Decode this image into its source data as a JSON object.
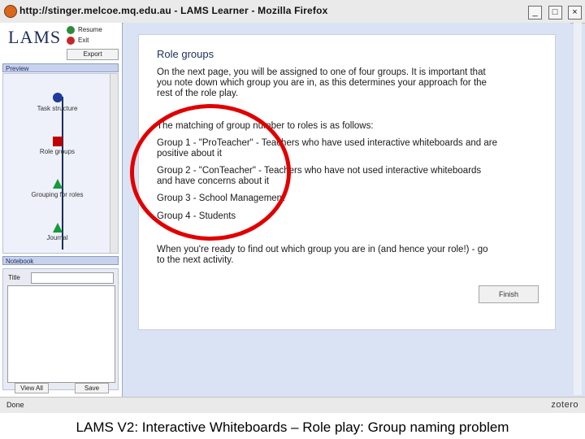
{
  "window": {
    "title": "http://stinger.melcoe.mq.edu.au - LAMS Learner - Mozilla Firefox",
    "minimize": "_",
    "maximize": "□",
    "close": "×"
  },
  "sidebar": {
    "logo": "LAMS",
    "resume_label": "Resume",
    "exit_label": "Exit",
    "export_label": "Export",
    "preview_header": "Preview",
    "sequence": [
      {
        "label": "Task structure",
        "shape": "circle",
        "color": "#1f3a9c"
      },
      {
        "label": "Role groups",
        "shape": "square",
        "color": "#c00000"
      },
      {
        "label": "Grouping for roles",
        "shape": "triangle",
        "color": "#169a3a"
      },
      {
        "label": "Journal",
        "shape": "triangle",
        "color": "#169a3a"
      }
    ],
    "notebook_header": "Notebook",
    "title_label": "Title",
    "title_value": "",
    "view_all_label": "View All",
    "save_label": "Save"
  },
  "content": {
    "heading": "Role groups",
    "intro": "On the next page, you will be assigned to one of four groups. It is important that you note down which group you are in, as this determines your approach for the rest of the role play.",
    "matching": "The matching of group number to roles is as follows:",
    "groups": [
      "Group 1 - \"ProTeacher\" - Teachers who have used interactive whiteboards and are positive about it",
      "Group 2 - \"ConTeacher\" - Teachers who have not used interactive whiteboards and have concerns about it",
      "Group 3 - School Management",
      "Group 4 - Students"
    ],
    "closing": "When you're ready to find out which group you are in (and hence your role!) - go to the next activity.",
    "finish_label": "Finish"
  },
  "status": {
    "text": "Done",
    "addon": "zotero"
  },
  "caption": "LAMS V2: Interactive Whiteboards – Role play: Group naming problem",
  "annotation_color": "#e00000"
}
